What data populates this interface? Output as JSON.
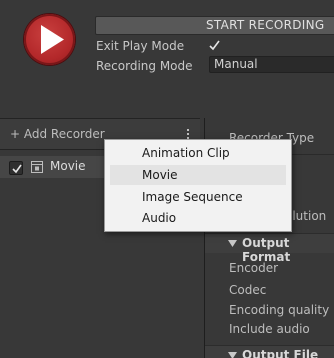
{
  "recorder_window": {
    "start_recording_label": "START RECORDING",
    "exit_play_mode_label": "Exit Play Mode",
    "exit_play_mode_checked": true,
    "recording_mode_label": "Recording Mode",
    "recording_mode_value": "Manual"
  },
  "recorder_list": {
    "add_recorder_label": "+ Add Recorder",
    "items": [
      {
        "label": "Movie",
        "checked": true
      }
    ]
  },
  "add_recorder_menu": {
    "items": [
      {
        "label": "Animation Clip"
      },
      {
        "label": "Movie",
        "highlighted": true
      },
      {
        "label": "Image Sequence"
      },
      {
        "label": "Audio"
      }
    ]
  },
  "inspector": {
    "recorder_type_label": "Recorder Type",
    "solution_label": "olution",
    "output_format_header": "Output Format",
    "fields": [
      "Encoder",
      "Codec",
      "Encoding quality",
      "Include audio"
    ],
    "output_file_header": "Output File"
  },
  "colors": {
    "record_button": "#b3282a",
    "background": "#383838",
    "menu_background": "#f2f2f2"
  },
  "icons": {
    "record_button": "play-triangle-icon",
    "recorder_item": "movie-clapper-icon",
    "menu": "kebab-menu-icon",
    "section_toggle": "triangle-down-icon"
  }
}
